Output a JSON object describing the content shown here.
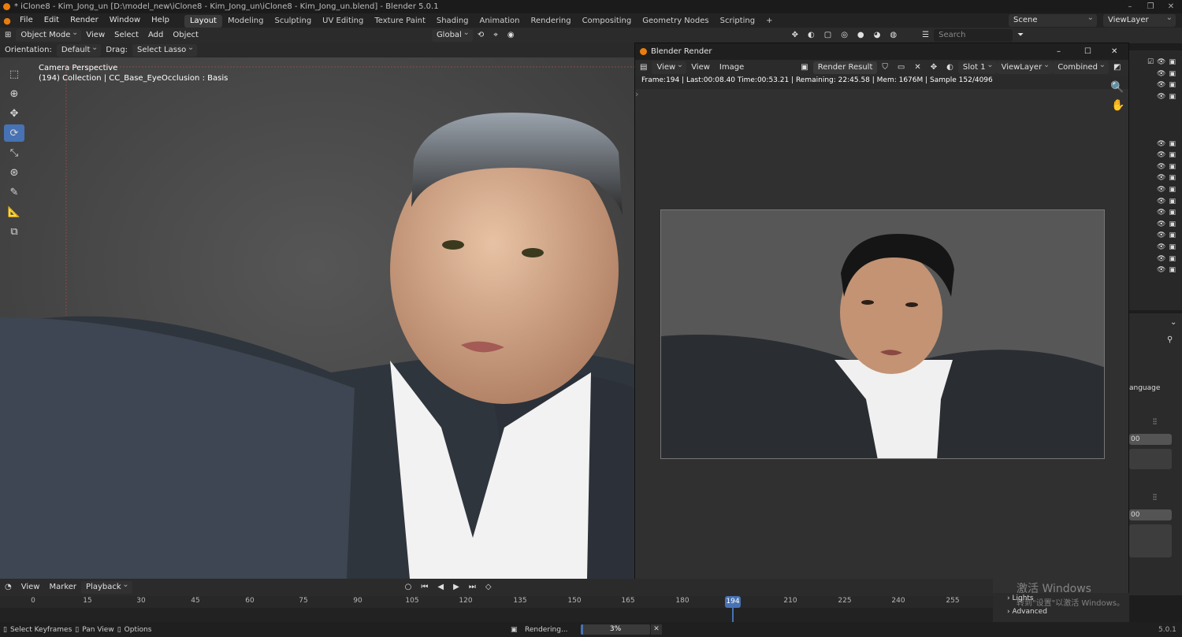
{
  "window": {
    "title": "* iClone8 - Kim_Jong_un [D:\\model_new\\iClone8 - Kim_Jong_un\\iClone8 - Kim_Jong_un.blend] - Blender 5.0.1"
  },
  "menu": [
    "File",
    "Edit",
    "Render",
    "Window",
    "Help"
  ],
  "workspaces": [
    "Layout",
    "Modeling",
    "Sculpting",
    "UV Editing",
    "Texture Paint",
    "Shading",
    "Animation",
    "Rendering",
    "Compositing",
    "Geometry Nodes",
    "Scripting"
  ],
  "workspace_add": "+",
  "topright": {
    "scene": "Scene",
    "viewlayer": "ViewLayer"
  },
  "viewport_header": {
    "mode": "Object Mode",
    "view": "View",
    "select": "Select",
    "add": "Add",
    "object": "Object",
    "transform": "Global",
    "search_placeholder": "Search"
  },
  "tool_header": {
    "orientation_label": "Orientation:",
    "orientation": "Default",
    "drag_label": "Drag:",
    "drag": "Select Lasso"
  },
  "viewport": {
    "line1": "Camera Perspective",
    "line2": "(194) Collection | CC_Base_EyeOcclusion : Basis"
  },
  "render_window": {
    "title": "Blender Render",
    "view": "View",
    "view2": "View",
    "image": "Image",
    "render_result": "Render Result",
    "slot": "Slot 1",
    "viewlayer": "ViewLayer",
    "pass": "Combined",
    "status": "Frame:194 | Last:00:08.40 Time:00:53.21 | Remaining: 22:45.58 | Mem: 1676M | Sample 152/4096"
  },
  "properties": {
    "language": "anguage",
    "value1": "00",
    "value2": "00",
    "lights": "Lights",
    "advanced": "Advanced"
  },
  "timeline": {
    "view": "View",
    "marker": "Marker",
    "playback": "Playback",
    "ticks": [
      "0",
      "15",
      "30",
      "45",
      "60",
      "75",
      "90",
      "105",
      "120",
      "135",
      "150",
      "165",
      "180",
      "210",
      "225",
      "240",
      "255"
    ],
    "current_frame": "194"
  },
  "statusbar": {
    "select": "Select Keyframes",
    "pan": "Pan View",
    "options": "Options",
    "rendering": "Rendering...",
    "progress_label": "3%",
    "progress": 0.03
  },
  "watermark": {
    "line1": "激活 Windows",
    "line2": "转到\"设置\"以激活 Windows。"
  }
}
